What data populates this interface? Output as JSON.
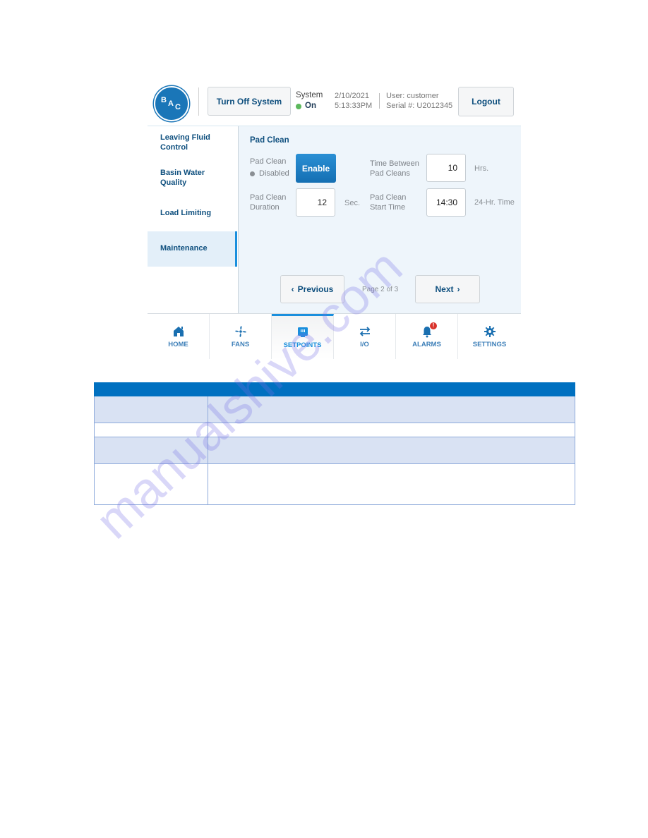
{
  "header": {
    "logo_text": "BAC",
    "turn_off_label": "Turn Off System",
    "system_label": "System",
    "system_status": "On",
    "status_color": "#5cb85c",
    "date": "2/10/2021",
    "time": "5:13:33PM",
    "user": "User: customer",
    "serial": "Serial #: U2012345",
    "logout_label": "Logout"
  },
  "sidebar": {
    "items": [
      {
        "label": "Leaving Fluid Control"
      },
      {
        "label": "Basin Water Quality"
      },
      {
        "label": "Load Limiting"
      },
      {
        "label": "Maintenance",
        "active": true
      }
    ]
  },
  "content": {
    "section_title": "Pad Clean",
    "pad_clean_label": "Pad Clean",
    "pad_clean_status": "Disabled",
    "enable_label": "Enable",
    "duration_label_1": "Pad Clean",
    "duration_label_2": "Duration",
    "duration_value": "12",
    "duration_unit": "Sec.",
    "between_label_1": "Time Between",
    "between_label_2": "Pad Cleans",
    "between_value": "10",
    "between_unit": "Hrs.",
    "start_label_1": "Pad Clean",
    "start_label_2": "Start Time",
    "start_value": "14:30",
    "start_unit": "24-Hr. Time",
    "previous_label": "Previous",
    "next_label": "Next",
    "page_indicator": "Page 2 of 3"
  },
  "nav": {
    "items": [
      {
        "label": "HOME",
        "icon": "home-icon"
      },
      {
        "label": "FANS",
        "icon": "fan-icon"
      },
      {
        "label": "SETPOINTS",
        "icon": "setpoints-icon",
        "active": true
      },
      {
        "label": "I/O",
        "icon": "swap-arrows-icon"
      },
      {
        "label": "ALARMS",
        "icon": "bell-icon",
        "badge": "!"
      },
      {
        "label": "SETTINGS",
        "icon": "gear-icon"
      }
    ]
  },
  "doc_table": {
    "headers": [
      "",
      ""
    ],
    "rows": [
      [
        "",
        ""
      ],
      [
        "",
        ""
      ],
      [
        "",
        ""
      ],
      [
        "",
        ""
      ]
    ]
  },
  "watermark": "manualshive.com"
}
